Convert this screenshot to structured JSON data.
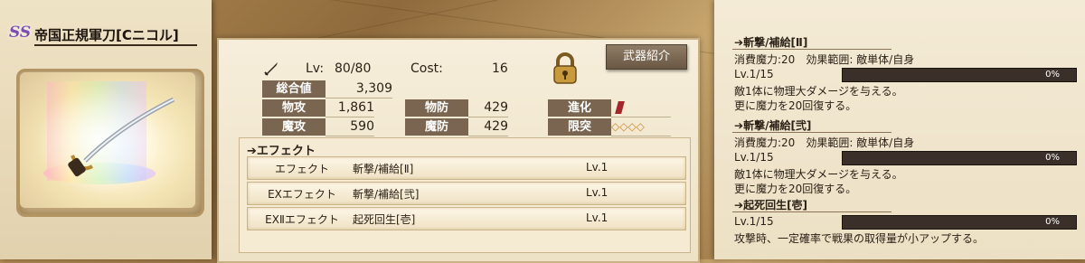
{
  "weapon": {
    "rarity_badge": "SS",
    "name": "帝国正規軍刀[Cニコル]",
    "image": "saber-icon"
  },
  "stats": {
    "lv_label": "Lv:",
    "lv_value": "80/80",
    "cost_label": "Cost:",
    "cost_value": "16",
    "total_label": "総合値",
    "total_value": "3,309",
    "patk_label": "物攻",
    "patk_value": "1,861",
    "pdef_label": "物防",
    "pdef_value": "429",
    "matk_label": "魔攻",
    "matk_value": "590",
    "mdef_label": "魔防",
    "mdef_value": "429",
    "evolve_label": "進化",
    "limit_label": "限突",
    "limit_stars": "◇◇◇◇"
  },
  "buttons": {
    "intro": "武器紹介"
  },
  "effects": {
    "header": "エフェクト",
    "rows": [
      {
        "type": "エフェクト",
        "name": "斬撃/補給[Ⅱ]",
        "lv": "Lv.1"
      },
      {
        "type": "EXエフェクト",
        "name": "斬撃/補給[弐]",
        "lv": "Lv.1"
      },
      {
        "type": "EXⅡエフェクト",
        "name": "起死回生[壱]",
        "lv": "Lv.1"
      }
    ]
  },
  "skills": [
    {
      "title": "斬撃/補給[Ⅱ]",
      "cost": "消費魔力:20　効果範囲: 敵単体/自身",
      "lv": "Lv.1/15",
      "pct": "0%",
      "progress": 0,
      "desc1": "敵1体に物理大ダメージを与える。",
      "desc2": "更に魔力を20回復する。"
    },
    {
      "title": "斬撃/補給[弐]",
      "cost": "消費魔力:20　効果範囲: 敵単体/自身",
      "lv": "Lv.1/15",
      "pct": "0%",
      "progress": 0,
      "desc1": "敵1体に物理大ダメージを与える。",
      "desc2": "更に魔力を20回復する。"
    },
    {
      "title": "起死回生[壱]",
      "lv": "Lv.1/15",
      "pct": "0%",
      "progress": 0,
      "desc1": "攻撃時、一定確率で戦果の取得量が小アップする。"
    }
  ],
  "colors": {
    "panel": "#f3e9d3",
    "label_bg": "#7a6650",
    "bar": "#3b3029",
    "evolve_mark": "#a3262b"
  }
}
